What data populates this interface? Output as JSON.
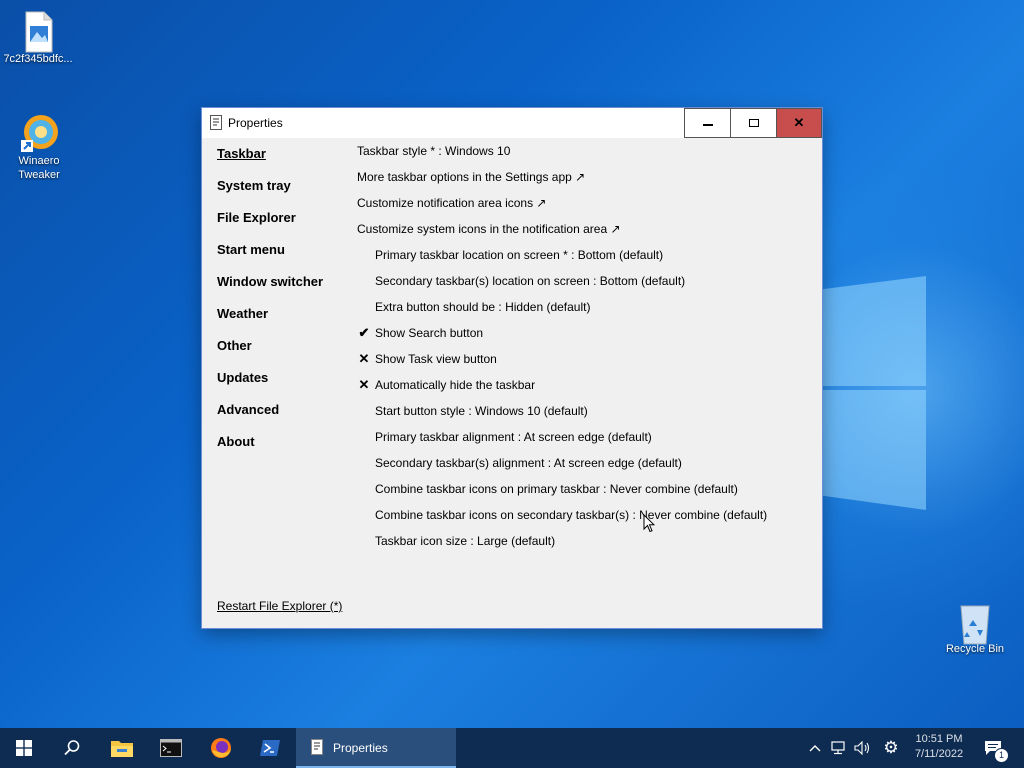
{
  "desktop": {
    "icons": [
      {
        "label": "7c2f345bdfc...",
        "icon": "image-file-icon"
      },
      {
        "label": "Winaero Tweaker",
        "icon": "winaero-tweaker-icon"
      },
      {
        "label": "Recycle Bin",
        "icon": "recycle-bin-icon"
      }
    ]
  },
  "window": {
    "title": "Properties",
    "controls": {
      "minimize": "minimize-icon",
      "maximize": "maximize-icon",
      "close": "close-icon"
    },
    "nav": [
      {
        "label": "Taskbar",
        "active": true
      },
      {
        "label": "System tray"
      },
      {
        "label": "File Explorer"
      },
      {
        "label": "Start menu"
      },
      {
        "label": "Window switcher"
      },
      {
        "label": "Weather"
      },
      {
        "label": "Other"
      },
      {
        "label": "Updates"
      },
      {
        "label": "Advanced"
      },
      {
        "label": "About"
      }
    ],
    "options": [
      {
        "text": "Taskbar style * : Windows 10",
        "mark": ""
      },
      {
        "text": "More taskbar options in the Settings app ↗",
        "mark": ""
      },
      {
        "text": "Customize notification area icons ↗",
        "mark": ""
      },
      {
        "text": "Customize system icons in the notification area ↗",
        "mark": ""
      },
      {
        "text": "Primary taskbar location on screen * : Bottom (default)",
        "mark": ""
      },
      {
        "text": "Secondary taskbar(s) location on screen : Bottom (default)",
        "mark": ""
      },
      {
        "text": "Extra button should be : Hidden (default)",
        "mark": ""
      },
      {
        "text": "Show Search button",
        "mark": "✔"
      },
      {
        "text": "Show Task view button",
        "mark": "✕"
      },
      {
        "text": "Automatically hide the taskbar",
        "mark": "✕"
      },
      {
        "text": "Start button style : Windows 10 (default)",
        "mark": ""
      },
      {
        "text": "Primary taskbar alignment : At screen edge (default)",
        "mark": ""
      },
      {
        "text": "Secondary taskbar(s) alignment : At screen edge (default)",
        "mark": ""
      },
      {
        "text": "Combine taskbar icons on primary taskbar : Never combine (default)",
        "mark": ""
      },
      {
        "text": "Combine taskbar icons on secondary taskbar(s) : Never combine (default)",
        "mark": ""
      },
      {
        "text": "Taskbar icon size : Large (default)",
        "mark": ""
      }
    ],
    "restart_link": "Restart File Explorer (*)"
  },
  "taskbar": {
    "start": "windows-start-icon",
    "search": "search-icon",
    "pinned": [
      "file-explorer-icon",
      "command-prompt-icon",
      "firefox-icon",
      "powershell-icon"
    ],
    "active_app": {
      "label": "Properties",
      "icon": "properties-app-icon"
    },
    "tray": [
      "chevron-up-icon",
      "network-icon",
      "volume-icon",
      "gear-icon"
    ],
    "clock": {
      "time": "10:51 PM",
      "date": "7/11/2022"
    },
    "notification_count": "1"
  }
}
